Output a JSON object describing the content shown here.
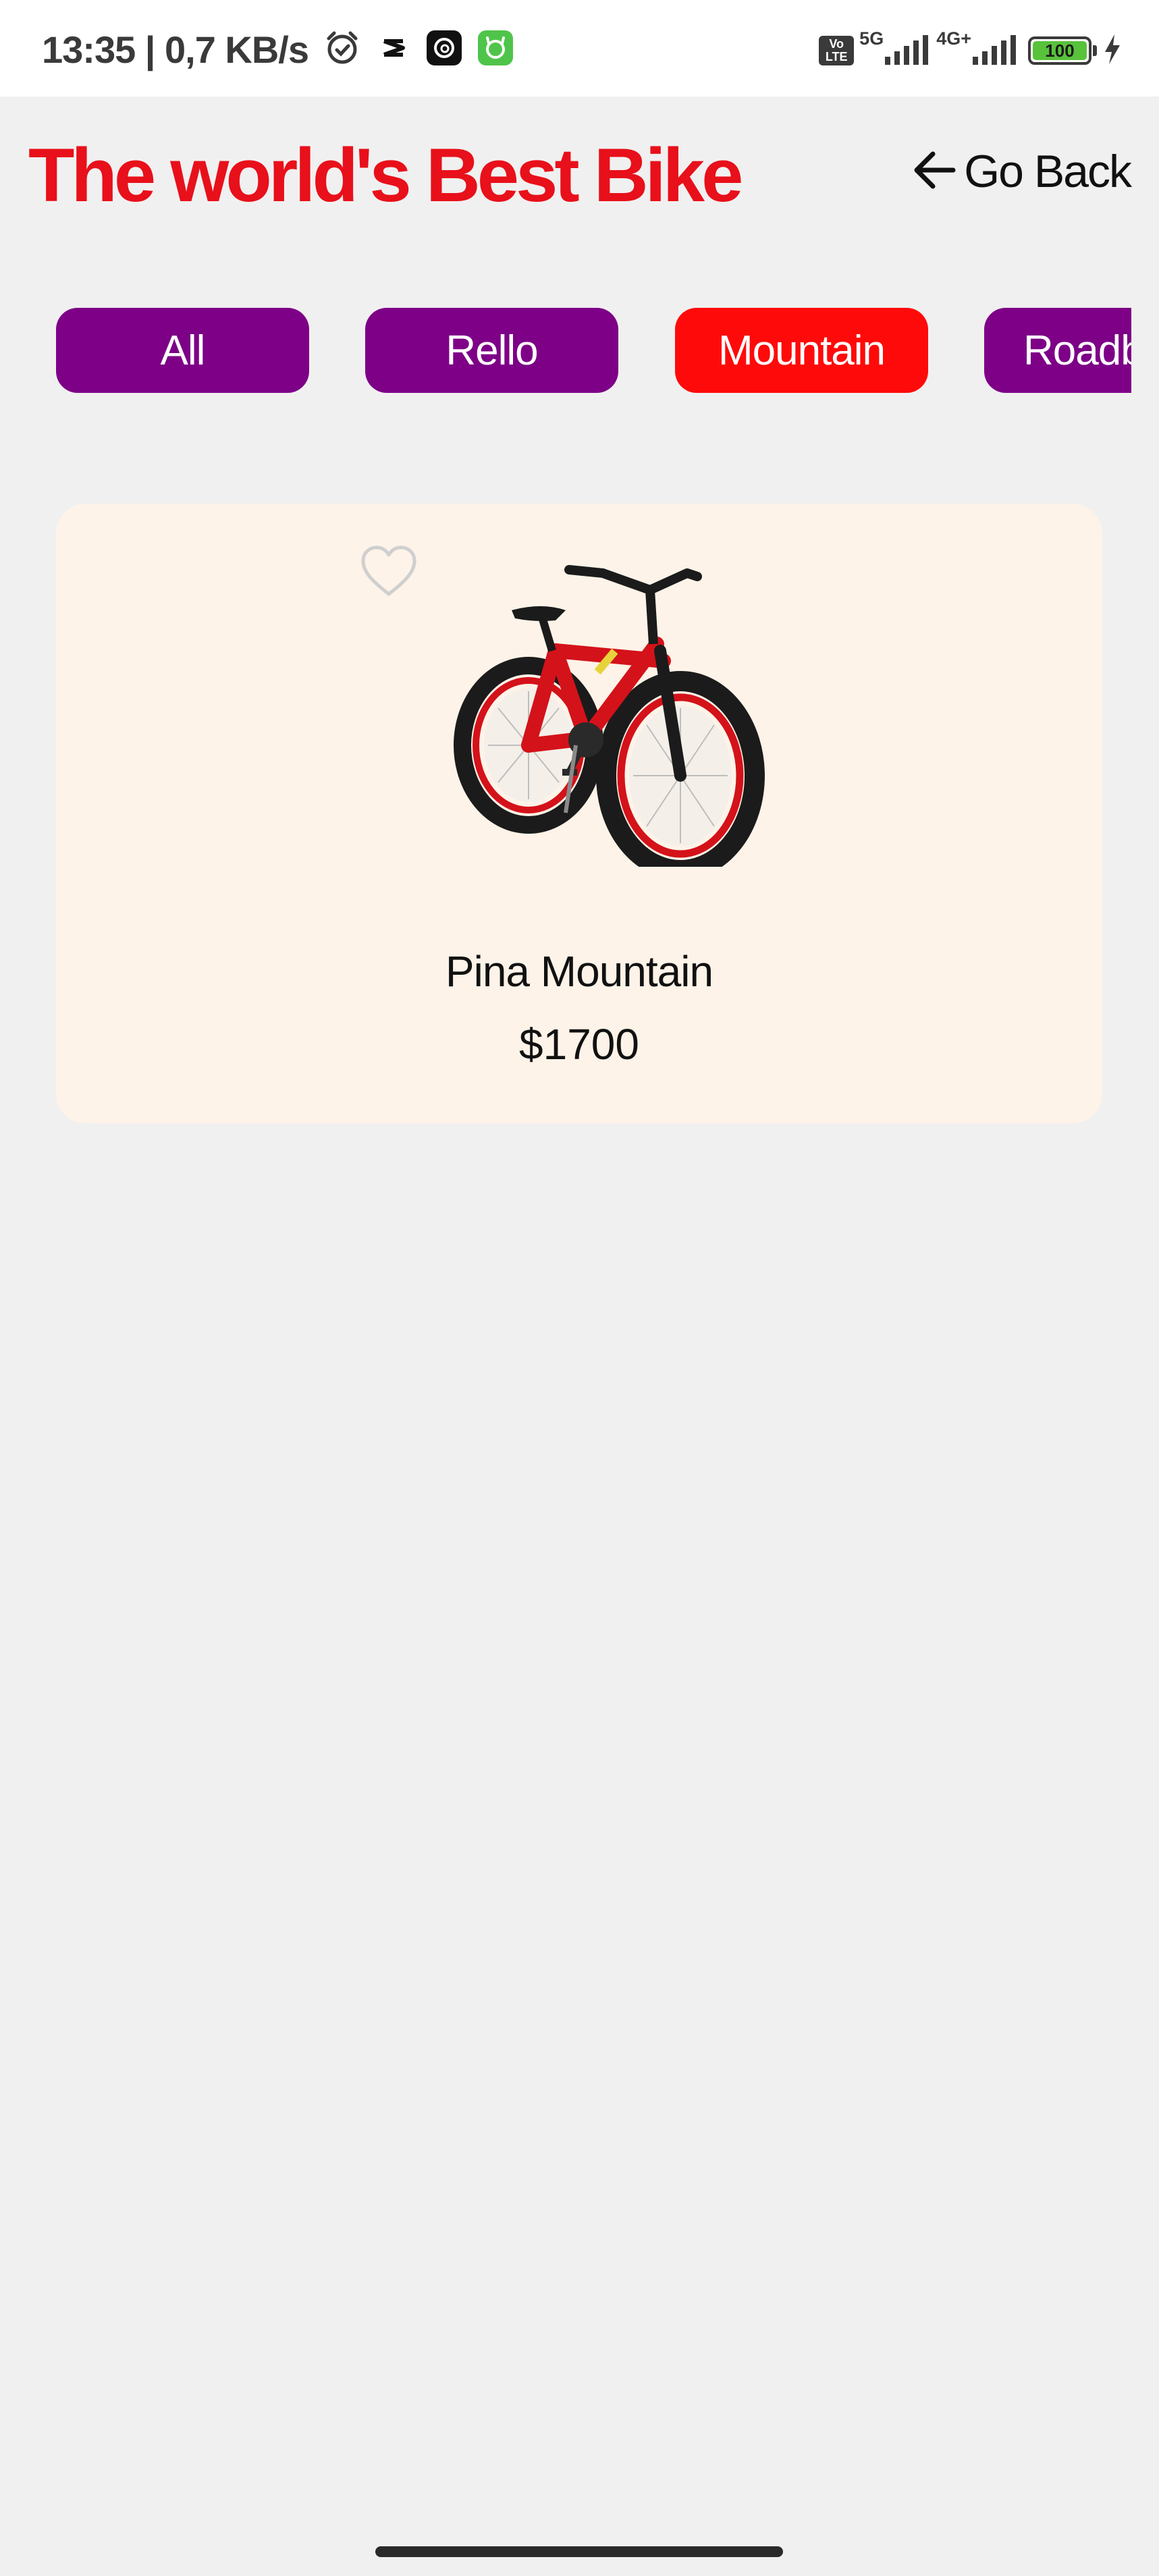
{
  "status_bar": {
    "time_speed": "13:35 | 0,7 KB/s",
    "volte": "Vo\nLTE",
    "network_1": "5G",
    "network_2": "4G+",
    "battery": "100",
    "icons": [
      "alarm-icon",
      "capcut-icon",
      "threads-icon",
      "app-icon",
      "signal-icon",
      "charging-icon"
    ]
  },
  "header": {
    "title": "The world's Best Bike",
    "back_label": "Go Back"
  },
  "categories": [
    {
      "label": "All",
      "active": false
    },
    {
      "label": "Rello",
      "active": false
    },
    {
      "label": "Mountain",
      "active": true
    },
    {
      "label": "Roadbike",
      "active": false
    }
  ],
  "products": [
    {
      "name": "Pina Mountain",
      "price": "$1700",
      "favorite": false
    }
  ],
  "colors": {
    "title": "#e8101a",
    "chip": "#7d0087",
    "chip_active": "#ff0a0a",
    "card": "#fdf3e8",
    "background": "#f1f0f0"
  }
}
